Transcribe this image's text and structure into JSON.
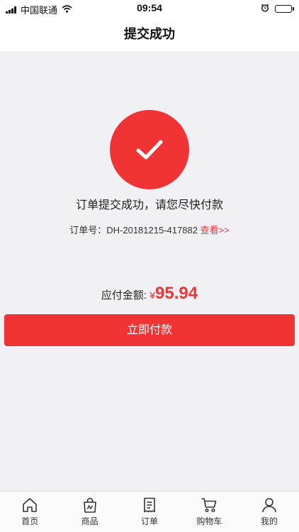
{
  "status_bar": {
    "carrier": "中国联通",
    "time": "09:54"
  },
  "nav": {
    "title": "提交成功"
  },
  "result": {
    "message": "订单提交成功，请您尽快付款",
    "order_label": "订单号：",
    "order_number": "DH-20181215-417882",
    "view_link": "查看>>"
  },
  "payment": {
    "label": "应付金额:",
    "currency": "¥",
    "amount": "95.94",
    "button_label": "立即付款"
  },
  "tabbar": {
    "items": [
      {
        "label": "首页",
        "icon": "home-icon"
      },
      {
        "label": "商品",
        "icon": "shopping-bag-icon"
      },
      {
        "label": "订单",
        "icon": "order-list-icon"
      },
      {
        "label": "购物车",
        "icon": "cart-icon"
      },
      {
        "label": "我的",
        "icon": "user-icon"
      }
    ]
  },
  "colors": {
    "accent": "#f03435",
    "link": "#e03a3a",
    "background": "#f1f0f5"
  }
}
